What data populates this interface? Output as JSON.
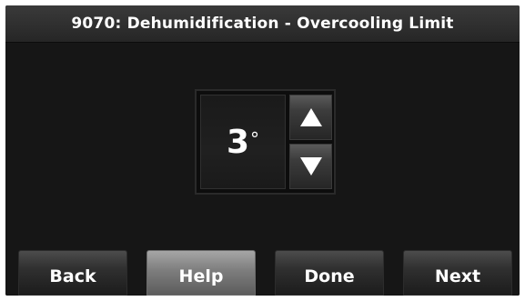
{
  "header": {
    "title": "9070: Dehumidification - Overcooling Limit"
  },
  "setting": {
    "value": "3",
    "unit": "°",
    "up_icon": "arrow-up-icon",
    "down_icon": "arrow-down-icon"
  },
  "footer": {
    "back_label": "Back",
    "help_label": "Help",
    "done_label": "Done",
    "next_label": "Next"
  },
  "colors": {
    "screen_background": "#141414",
    "header_background": "#2e2e2e",
    "button_background": "#303030",
    "help_button_background": "#7d7d7d",
    "text": "#ffffff"
  }
}
